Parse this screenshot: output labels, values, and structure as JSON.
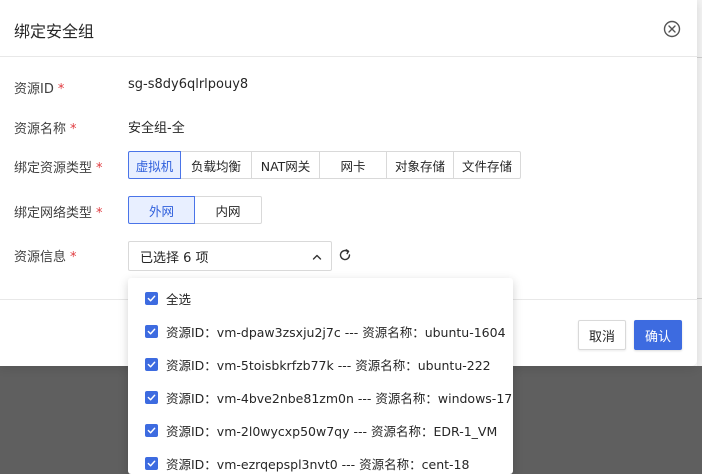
{
  "modal": {
    "title": "绑定安全组",
    "close_icon": "close-circle-icon"
  },
  "form": {
    "resource_id": {
      "label": "资源ID",
      "required_mark": "*",
      "value": "sg-s8dy6qlrlpouy8"
    },
    "resource_name": {
      "label": "资源名称",
      "required_mark": "*",
      "value": "安全组-全"
    },
    "bind_resource_type": {
      "label": "绑定资源类型",
      "required_mark": "*",
      "options": [
        "虚拟机",
        "负载均衡",
        "NAT网关",
        "网卡",
        "对象存储",
        "文件存储"
      ],
      "selected": "虚拟机"
    },
    "bind_network_type": {
      "label": "绑定网络类型",
      "required_mark": "*",
      "options": [
        "外网",
        "内网"
      ],
      "selected": "外网"
    },
    "resource_info": {
      "label": "资源信息",
      "required_mark": "*",
      "select_value": "已选择 6 项",
      "chevron_icon": "chevron-up-icon",
      "refresh_icon": "refresh-icon"
    }
  },
  "dropdown": {
    "items": [
      {
        "label": "全选",
        "checked": true
      },
      {
        "label": "资源ID：vm-dpaw3zsxju2j7c --- 资源名称：ubuntu-1604",
        "checked": true
      },
      {
        "label": "资源ID：vm-5toisbkrfzb77k --- 资源名称：ubuntu-222",
        "checked": true
      },
      {
        "label": "资源ID：vm-4bve2nbe81zm0n --- 资源名称：windows-17",
        "checked": true
      },
      {
        "label": "资源ID：vm-2l0wycxp50w7qy --- 资源名称：EDR-1_VM",
        "checked": true
      },
      {
        "label": "资源ID：vm-ezrqepspl3nvt0 --- 资源名称：cent-18",
        "checked": true
      }
    ]
  },
  "footer": {
    "cancel_label": "取消",
    "ok_label": "确认"
  },
  "colors": {
    "primary": "#3d6be0",
    "required": "#e0393e",
    "active_bg": "#e8efff"
  }
}
